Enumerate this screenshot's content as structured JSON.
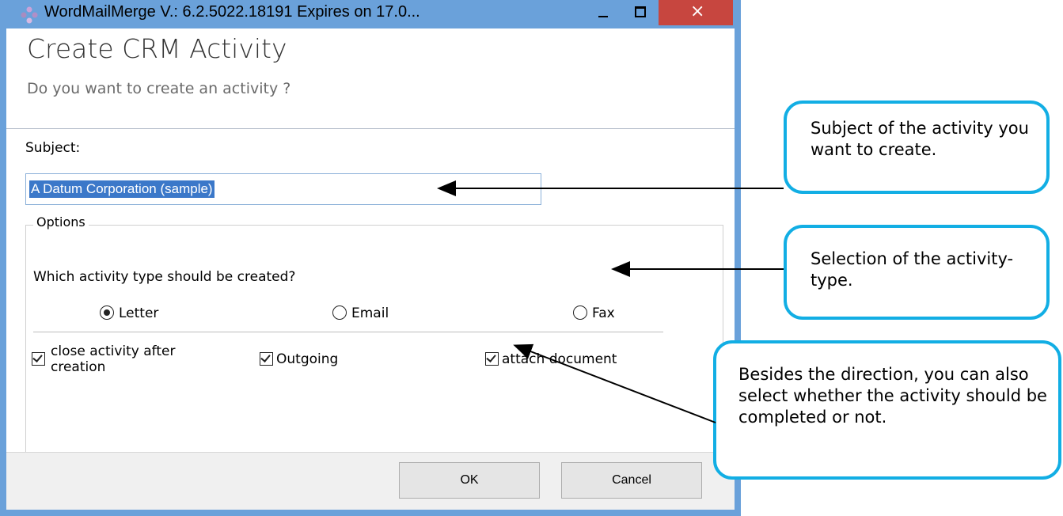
{
  "window": {
    "title": "WordMailMerge V.: 6.2.5022.18191 Expires on 17.0...",
    "close_glyph": "×",
    "accent_close": "#c7463f",
    "border_color": "#6aa1da"
  },
  "header": {
    "title": "Create CRM Activity",
    "subtitle": "Do you want to create an activity ?"
  },
  "form": {
    "subject_label": "Subject:",
    "subject_value": "A Datum Corporation (sample)",
    "options_legend": "Options",
    "activity_question": "Which activity type should be created?",
    "radios": [
      {
        "label": "Letter",
        "selected": true
      },
      {
        "label": "Email",
        "selected": false
      },
      {
        "label": "Fax",
        "selected": false
      }
    ],
    "checkboxes": [
      {
        "label": "close activity after creation",
        "checked": true
      },
      {
        "label": "Outgoing",
        "checked": true
      },
      {
        "label": "attach document",
        "checked": true
      }
    ]
  },
  "footer": {
    "ok_label": "OK",
    "cancel_label": "Cancel"
  },
  "callouts": {
    "subject_note": "Subject of the activity you want to create.",
    "type_note": "Selection of the activity-type.",
    "direction_note": "Besides the direction, you can also select whether the activity should be completed or not.",
    "border_color": "#12aee4"
  }
}
